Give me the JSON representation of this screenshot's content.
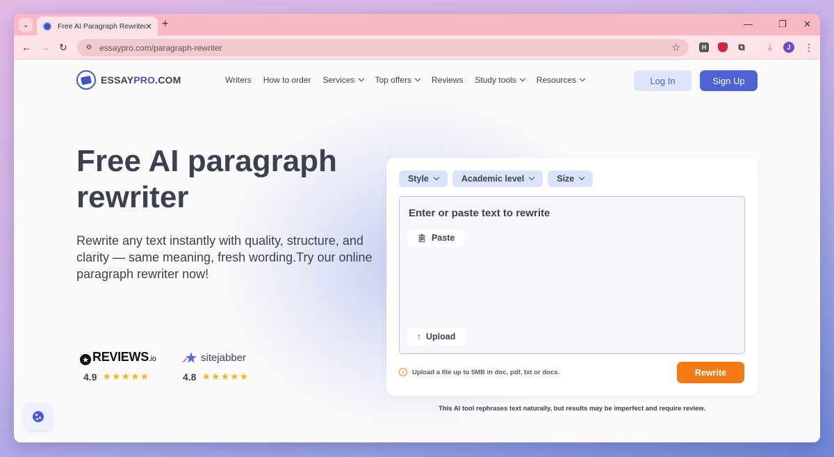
{
  "browser": {
    "tab_title": "Free AI Paragraph Rewriter",
    "url": "essaypro.com/paragraph-rewriter",
    "profile_initial": "J",
    "extensions": [
      "H",
      "shield",
      "puzzle",
      "download"
    ]
  },
  "header": {
    "logo_prefix": "ESSAY",
    "logo_highlight": "PRO",
    "logo_suffix": ".COM",
    "nav": [
      {
        "label": "Writers",
        "dropdown": false
      },
      {
        "label": "How to order",
        "dropdown": false
      },
      {
        "label": "Services",
        "dropdown": true
      },
      {
        "label": "Top offers",
        "dropdown": true
      },
      {
        "label": "Reviews",
        "dropdown": false
      },
      {
        "label": "Study tools",
        "dropdown": true
      },
      {
        "label": "Resources",
        "dropdown": true
      }
    ],
    "login_label": "Log In",
    "signup_label": "Sign Up"
  },
  "hero": {
    "title": "Free AI paragraph rewriter",
    "subtitle": "Rewrite any text instantly with quality, structure, and clarity — same meaning, fresh wording.Try our online paragraph rewriter now!"
  },
  "ratings": [
    {
      "brand": "REVIEWS",
      "brand_suffix": ".io",
      "score": "4.9",
      "stars": 5
    },
    {
      "brand": "sitejabber",
      "score": "4.8",
      "stars": 5
    }
  ],
  "tool": {
    "options": [
      {
        "label": "Style"
      },
      {
        "label": "Academic level"
      },
      {
        "label": "Size"
      }
    ],
    "placeholder": "Enter or paste text to rewrite",
    "paste_label": "Paste",
    "upload_label": "Upload",
    "upload_hint": "Upload a file up to 5MB in doc, pdf, txt or docx.",
    "rewrite_label": "Rewrite",
    "disclaimer": "This AI tool rephrases text naturally, but results may be imperfect and require review."
  },
  "colors": {
    "accent": "#4d63d4",
    "cta": "#f47a16",
    "star": "#f5b520",
    "tab_bar": "#f8b8c4"
  }
}
